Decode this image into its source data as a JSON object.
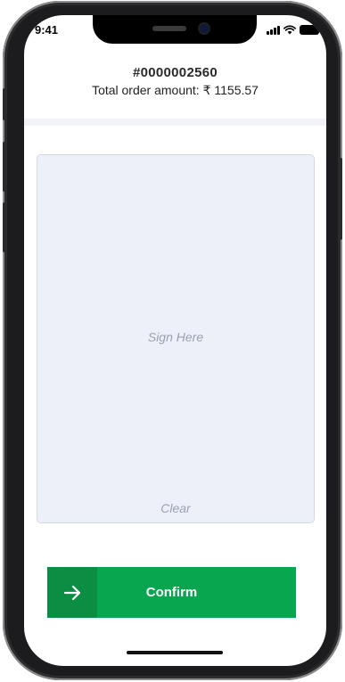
{
  "status_bar": {
    "time": "9:41",
    "icons": [
      "signal-icon",
      "wifi-icon",
      "battery-icon"
    ]
  },
  "order": {
    "id": "#0000002560",
    "total_text": "Total order amount: ₹ 1155.57"
  },
  "signature": {
    "placeholder": "Sign Here",
    "clear_label": "Clear"
  },
  "confirm": {
    "icon": "arrow-right-icon",
    "label": "Confirm"
  },
  "colors": {
    "primary": "#07a64f",
    "primary_dark": "#0b8d44",
    "pad_background": "#edf0f8",
    "muted_text": "#9aa0b3"
  }
}
